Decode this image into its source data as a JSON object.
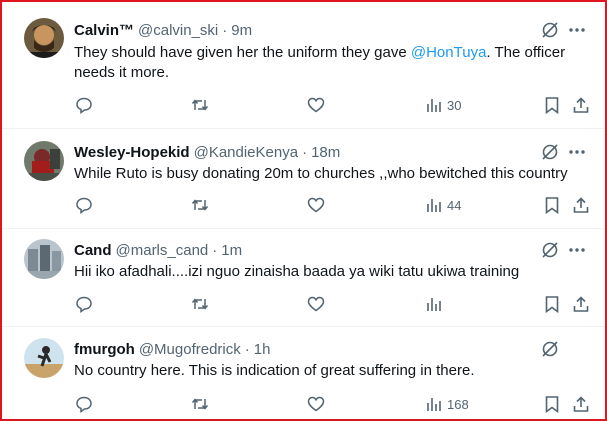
{
  "colors": {
    "mention": "#1d9bf0",
    "muted": "#536471",
    "text": "#0f1419",
    "frame": "#e0161f"
  },
  "icons": [
    "grok-icon",
    "more-icon",
    "reply-icon",
    "retweet-icon",
    "like-icon",
    "views-icon",
    "bookmark-icon",
    "share-icon"
  ],
  "tweets": [
    {
      "name": "Calvin™",
      "handle": "@calvin_ski",
      "dot": "·",
      "time": "9m",
      "text_before": "They should have given her the uniform they gave ",
      "mention": "@HonTuya",
      "text_after": ". The officer needs it more.",
      "views": "30"
    },
    {
      "name": "Wesley-Hopekid",
      "handle": "@KandieKenya",
      "dot": "·",
      "time": "18m",
      "text": "While Ruto is busy donating 20m to churches ,,who bewitched this country",
      "views": "44"
    },
    {
      "name": "Cand",
      "handle": "@marls_cand",
      "dot": "·",
      "time": "1m",
      "text": "Hii iko afadhali....izi nguo zinaisha baada ya wiki tatu ukiwa training",
      "views": ""
    },
    {
      "name": "fmurgoh",
      "handle": "@Mugofredrick",
      "dot": "·",
      "time": "1h",
      "text": "No country here. This is indication of great suffering in there.",
      "views": "168"
    }
  ]
}
